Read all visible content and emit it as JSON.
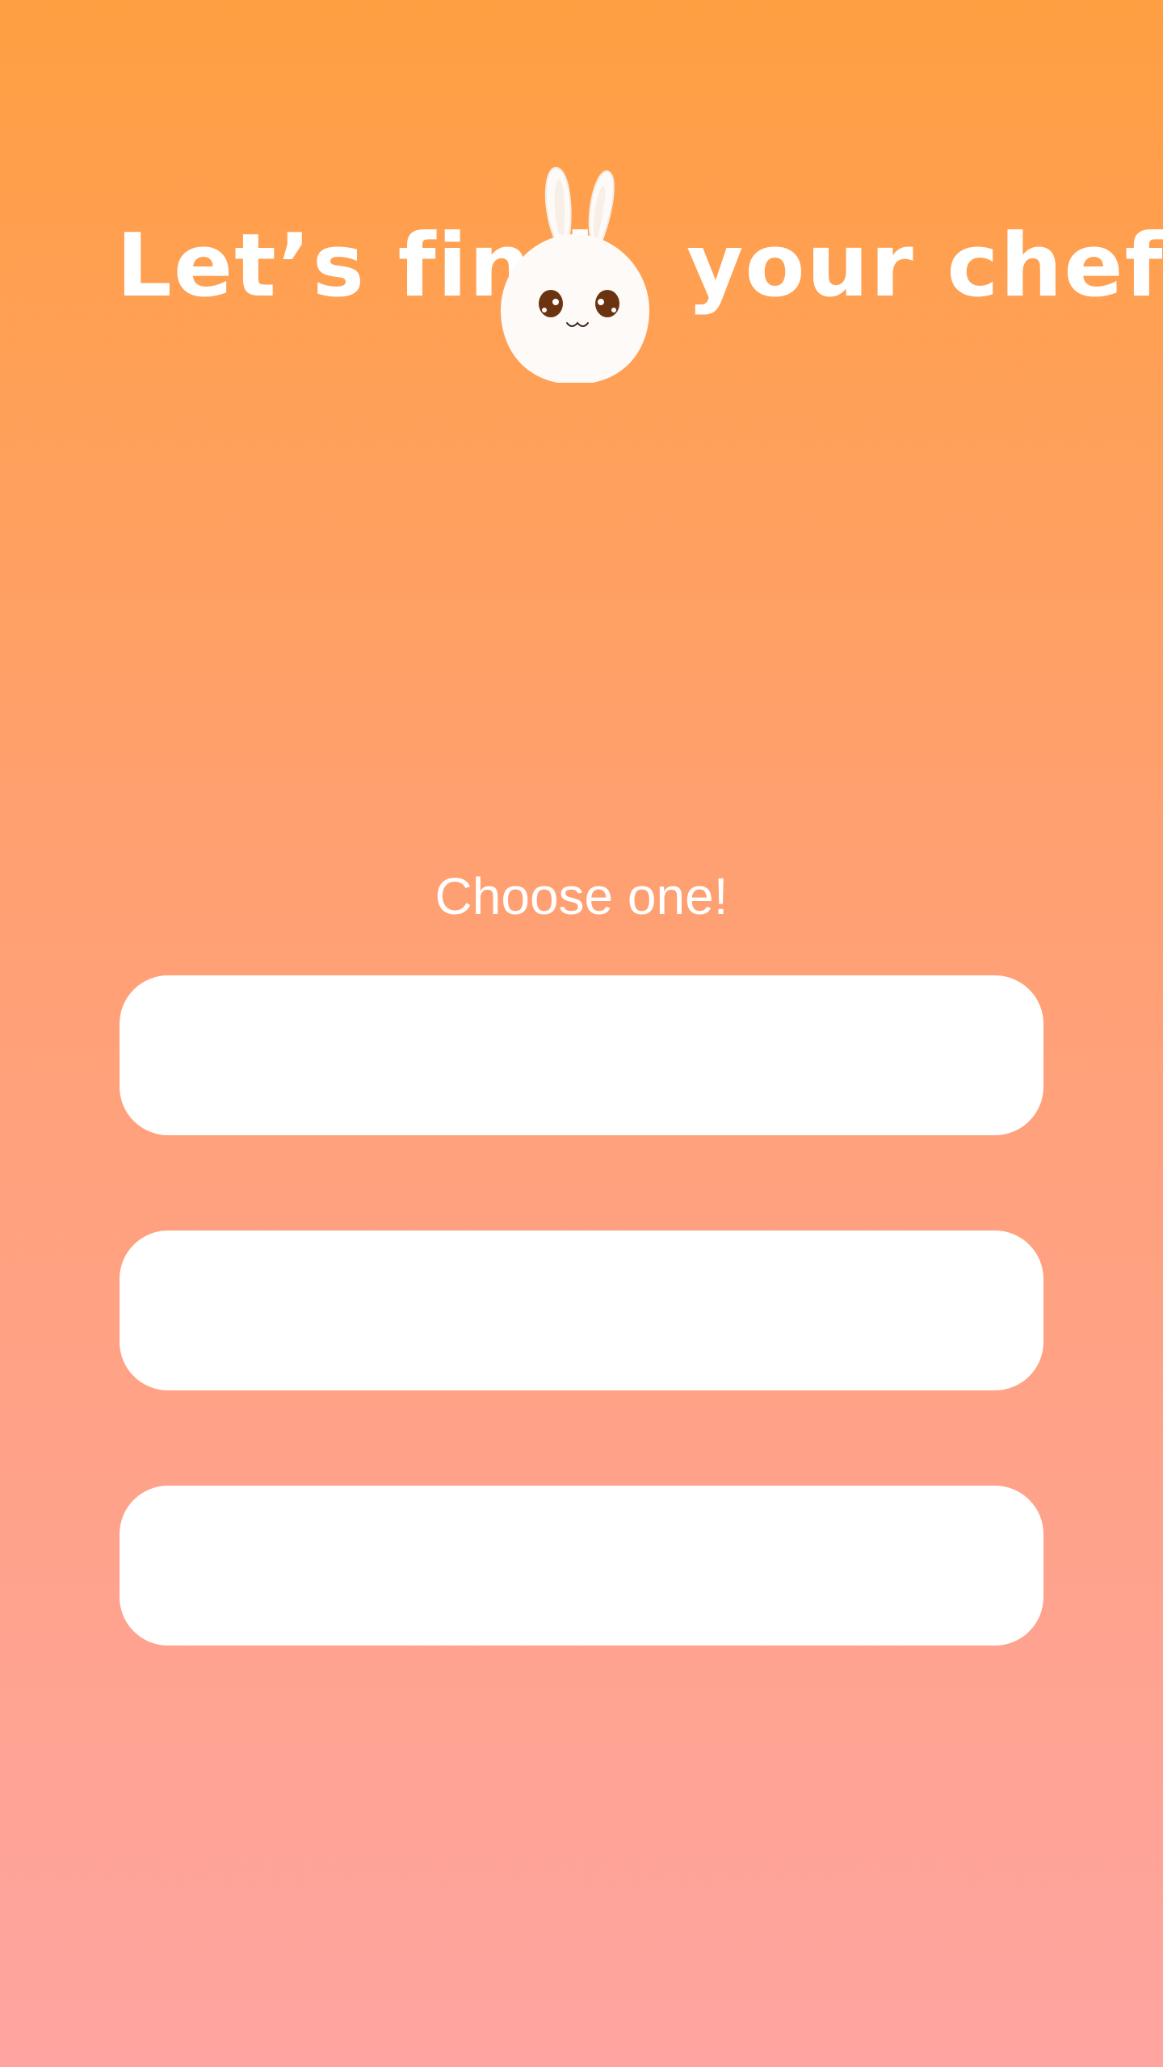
{
  "header": {
    "title_left": "Let’s find",
    "title_right": "your chef!",
    "mascot_icon": "bunny-face-icon"
  },
  "main": {
    "prompt": "Choose one!",
    "options": [
      {
        "label": ""
      },
      {
        "label": ""
      },
      {
        "label": ""
      }
    ]
  },
  "colors": {
    "gradient_top": "#ff9f42",
    "gradient_bottom": "#ffa4a0",
    "button_bg": "#ffffff",
    "text": "#ffffff",
    "bunny_eye": "#6b3310"
  }
}
